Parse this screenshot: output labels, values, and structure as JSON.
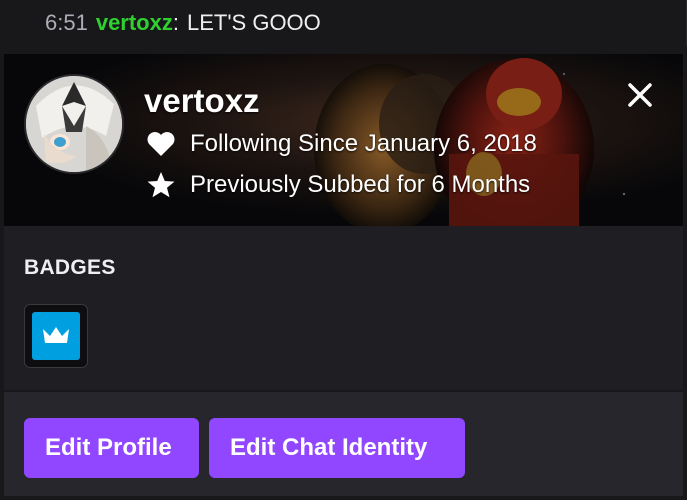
{
  "chat": {
    "timestamp": "6:51",
    "username": "vertoxz",
    "colon": ":",
    "message": "LET'S GOOO",
    "username_color": "#2fd12f"
  },
  "card": {
    "username": "vertoxz",
    "following_text": "Following Since January 6, 2018",
    "subscription_text": "Previously Subbed for 6 Months",
    "following_icon": "heart-icon",
    "subscription_icon": "star-icon",
    "close_icon": "close-icon"
  },
  "badges": {
    "title": "BADGES",
    "items": [
      {
        "icon": "crown-icon",
        "color": "#00a0e0"
      }
    ]
  },
  "actions": {
    "edit_profile_label": "Edit Profile",
    "edit_chat_identity_label": "Edit Chat Identity",
    "accent_color": "#9147ff"
  }
}
